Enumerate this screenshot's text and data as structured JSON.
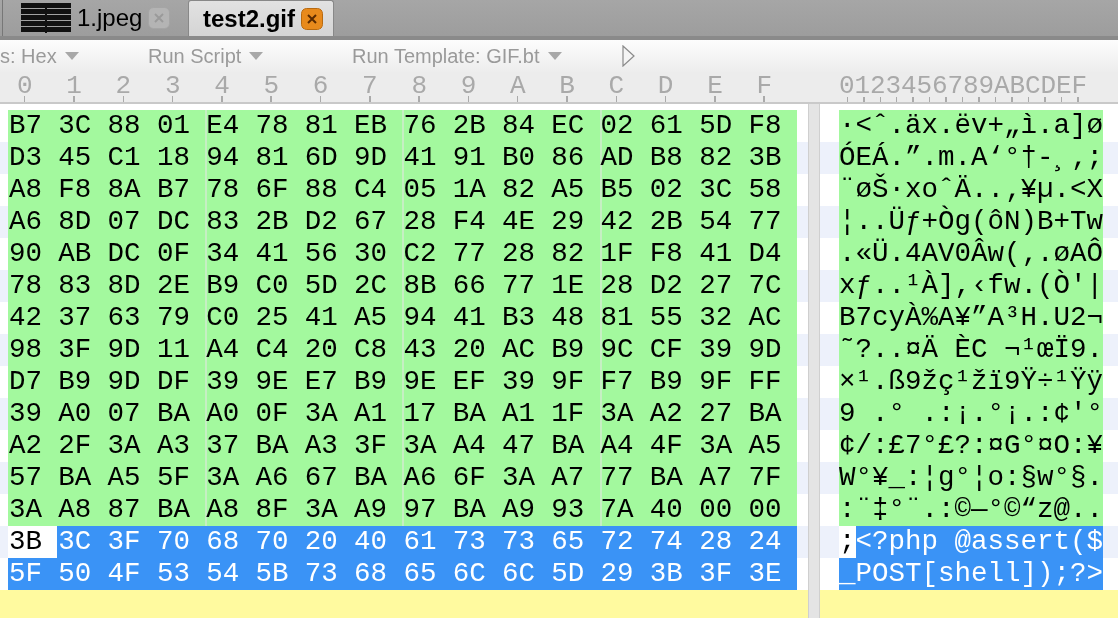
{
  "tabs": [
    {
      "label": "1.jpeg",
      "selected": false,
      "kind": "redacted"
    },
    {
      "label": "test2.gif",
      "selected": true,
      "kind": "plain"
    }
  ],
  "toolbar": [
    {
      "kind": "menu",
      "label": "s: Hex"
    },
    {
      "kind": "menu",
      "label": "Run Script"
    },
    {
      "kind": "menu",
      "label": "Run Template: GIF.bt"
    },
    {
      "kind": "play"
    }
  ],
  "ruler": {
    "hex_columns": [
      "0",
      "1",
      "2",
      "3",
      "4",
      "5",
      "6",
      "7",
      "8",
      "9",
      "A",
      "B",
      "C",
      "D",
      "E",
      "F"
    ],
    "text_header": "0123456789ABCDEF"
  },
  "rows": [
    {
      "template": true,
      "bytes": [
        {
          "hex": "B7",
          "char": "·",
          "selected": false
        },
        {
          "hex": "3C",
          "char": "<",
          "selected": false
        },
        {
          "hex": "88",
          "char": "ˆ",
          "selected": false
        },
        {
          "hex": "01",
          "char": ".",
          "selected": false
        },
        {
          "hex": "E4",
          "char": "ä",
          "selected": false
        },
        {
          "hex": "78",
          "char": "x",
          "selected": false
        },
        {
          "hex": "81",
          "char": ".",
          "selected": false
        },
        {
          "hex": "EB",
          "char": "ë",
          "selected": false
        },
        {
          "hex": "76",
          "char": "v",
          "selected": false
        },
        {
          "hex": "2B",
          "char": "+",
          "selected": false
        },
        {
          "hex": "84",
          "char": "„",
          "selected": false
        },
        {
          "hex": "EC",
          "char": "ì",
          "selected": false
        },
        {
          "hex": "02",
          "char": ".",
          "selected": false
        },
        {
          "hex": "61",
          "char": "a",
          "selected": false
        },
        {
          "hex": "5D",
          "char": "]",
          "selected": false
        },
        {
          "hex": "F8",
          "char": "ø",
          "selected": false
        }
      ]
    },
    {
      "template": true,
      "bytes": [
        {
          "hex": "D3",
          "char": "Ó",
          "selected": false
        },
        {
          "hex": "45",
          "char": "E",
          "selected": false
        },
        {
          "hex": "C1",
          "char": "Á",
          "selected": false
        },
        {
          "hex": "18",
          "char": ".",
          "selected": false
        },
        {
          "hex": "94",
          "char": "”",
          "selected": false
        },
        {
          "hex": "81",
          "char": ".",
          "selected": false
        },
        {
          "hex": "6D",
          "char": "m",
          "selected": false
        },
        {
          "hex": "9D",
          "char": ".",
          "selected": false
        },
        {
          "hex": "41",
          "char": "A",
          "selected": false
        },
        {
          "hex": "91",
          "char": "‘",
          "selected": false
        },
        {
          "hex": "B0",
          "char": "°",
          "selected": false
        },
        {
          "hex": "86",
          "char": "†",
          "selected": false
        },
        {
          "hex": "AD",
          "char": "-",
          "selected": false
        },
        {
          "hex": "B8",
          "char": "¸",
          "selected": false
        },
        {
          "hex": "82",
          "char": "‚",
          "selected": false
        },
        {
          "hex": "3B",
          "char": ";",
          "selected": false
        }
      ]
    },
    {
      "template": true,
      "bytes": [
        {
          "hex": "A8",
          "char": "¨",
          "selected": false
        },
        {
          "hex": "F8",
          "char": "ø",
          "selected": false
        },
        {
          "hex": "8A",
          "char": "Š",
          "selected": false
        },
        {
          "hex": "B7",
          "char": "·",
          "selected": false
        },
        {
          "hex": "78",
          "char": "x",
          "selected": false
        },
        {
          "hex": "6F",
          "char": "o",
          "selected": false
        },
        {
          "hex": "88",
          "char": "ˆ",
          "selected": false
        },
        {
          "hex": "C4",
          "char": "Ä",
          "selected": false
        },
        {
          "hex": "05",
          "char": ".",
          "selected": false
        },
        {
          "hex": "1A",
          "char": ".",
          "selected": false
        },
        {
          "hex": "82",
          "char": "‚",
          "selected": false
        },
        {
          "hex": "A5",
          "char": "¥",
          "selected": false
        },
        {
          "hex": "B5",
          "char": "µ",
          "selected": false
        },
        {
          "hex": "02",
          "char": ".",
          "selected": false
        },
        {
          "hex": "3C",
          "char": "<",
          "selected": false
        },
        {
          "hex": "58",
          "char": "X",
          "selected": false
        }
      ]
    },
    {
      "template": true,
      "bytes": [
        {
          "hex": "A6",
          "char": "¦",
          "selected": false
        },
        {
          "hex": "8D",
          "char": ".",
          "selected": false
        },
        {
          "hex": "07",
          "char": ".",
          "selected": false
        },
        {
          "hex": "DC",
          "char": "Ü",
          "selected": false
        },
        {
          "hex": "83",
          "char": "ƒ",
          "selected": false
        },
        {
          "hex": "2B",
          "char": "+",
          "selected": false
        },
        {
          "hex": "D2",
          "char": "Ò",
          "selected": false
        },
        {
          "hex": "67",
          "char": "g",
          "selected": false
        },
        {
          "hex": "28",
          "char": "(",
          "selected": false
        },
        {
          "hex": "F4",
          "char": "ô",
          "selected": false
        },
        {
          "hex": "4E",
          "char": "N",
          "selected": false
        },
        {
          "hex": "29",
          "char": ")",
          "selected": false
        },
        {
          "hex": "42",
          "char": "B",
          "selected": false
        },
        {
          "hex": "2B",
          "char": "+",
          "selected": false
        },
        {
          "hex": "54",
          "char": "T",
          "selected": false
        },
        {
          "hex": "77",
          "char": "w",
          "selected": false
        }
      ]
    },
    {
      "template": true,
      "bytes": [
        {
          "hex": "90",
          "char": ".",
          "selected": false
        },
        {
          "hex": "AB",
          "char": "«",
          "selected": false
        },
        {
          "hex": "DC",
          "char": "Ü",
          "selected": false
        },
        {
          "hex": "0F",
          "char": ".",
          "selected": false
        },
        {
          "hex": "34",
          "char": "4",
          "selected": false
        },
        {
          "hex": "41",
          "char": "A",
          "selected": false
        },
        {
          "hex": "56",
          "char": "V",
          "selected": false
        },
        {
          "hex": "30",
          "char": "0",
          "selected": false
        },
        {
          "hex": "C2",
          "char": "Â",
          "selected": false
        },
        {
          "hex": "77",
          "char": "w",
          "selected": false
        },
        {
          "hex": "28",
          "char": "(",
          "selected": false
        },
        {
          "hex": "82",
          "char": "‚",
          "selected": false
        },
        {
          "hex": "1F",
          "char": ".",
          "selected": false
        },
        {
          "hex": "F8",
          "char": "ø",
          "selected": false
        },
        {
          "hex": "41",
          "char": "A",
          "selected": false
        },
        {
          "hex": "D4",
          "char": "Ô",
          "selected": false
        }
      ]
    },
    {
      "template": true,
      "bytes": [
        {
          "hex": "78",
          "char": "x",
          "selected": false
        },
        {
          "hex": "83",
          "char": "ƒ",
          "selected": false
        },
        {
          "hex": "8D",
          "char": ".",
          "selected": false
        },
        {
          "hex": "2E",
          "char": ".",
          "selected": false
        },
        {
          "hex": "B9",
          "char": "¹",
          "selected": false
        },
        {
          "hex": "C0",
          "char": "À",
          "selected": false
        },
        {
          "hex": "5D",
          "char": "]",
          "selected": false
        },
        {
          "hex": "2C",
          "char": ",",
          "selected": false
        },
        {
          "hex": "8B",
          "char": "‹",
          "selected": false
        },
        {
          "hex": "66",
          "char": "f",
          "selected": false
        },
        {
          "hex": "77",
          "char": "w",
          "selected": false
        },
        {
          "hex": "1E",
          "char": ".",
          "selected": false
        },
        {
          "hex": "28",
          "char": "(",
          "selected": false
        },
        {
          "hex": "D2",
          "char": "Ò",
          "selected": false
        },
        {
          "hex": "27",
          "char": "'",
          "selected": false
        },
        {
          "hex": "7C",
          "char": "|",
          "selected": false
        }
      ]
    },
    {
      "template": true,
      "bytes": [
        {
          "hex": "42",
          "char": "B",
          "selected": false
        },
        {
          "hex": "37",
          "char": "7",
          "selected": false
        },
        {
          "hex": "63",
          "char": "c",
          "selected": false
        },
        {
          "hex": "79",
          "char": "y",
          "selected": false
        },
        {
          "hex": "C0",
          "char": "À",
          "selected": false
        },
        {
          "hex": "25",
          "char": "%",
          "selected": false
        },
        {
          "hex": "41",
          "char": "A",
          "selected": false
        },
        {
          "hex": "A5",
          "char": "¥",
          "selected": false
        },
        {
          "hex": "94",
          "char": "”",
          "selected": false
        },
        {
          "hex": "41",
          "char": "A",
          "selected": false
        },
        {
          "hex": "B3",
          "char": "³",
          "selected": false
        },
        {
          "hex": "48",
          "char": "H",
          "selected": false
        },
        {
          "hex": "81",
          "char": ".",
          "selected": false
        },
        {
          "hex": "55",
          "char": "U",
          "selected": false
        },
        {
          "hex": "32",
          "char": "2",
          "selected": false
        },
        {
          "hex": "AC",
          "char": "¬",
          "selected": false
        }
      ]
    },
    {
      "template": true,
      "bytes": [
        {
          "hex": "98",
          "char": "˜",
          "selected": false
        },
        {
          "hex": "3F",
          "char": "?",
          "selected": false
        },
        {
          "hex": "9D",
          "char": ".",
          "selected": false
        },
        {
          "hex": "11",
          "char": ".",
          "selected": false
        },
        {
          "hex": "A4",
          "char": "¤",
          "selected": false
        },
        {
          "hex": "C4",
          "char": "Ä",
          "selected": false
        },
        {
          "hex": "20",
          "selected": false
        },
        {
          "hex": "C8",
          "char": "È",
          "selected": false
        },
        {
          "hex": "43",
          "char": "C",
          "selected": false
        },
        {
          "hex": "20",
          "selected": false
        },
        {
          "hex": "AC",
          "char": "¬",
          "selected": false
        },
        {
          "hex": "B9",
          "char": "¹",
          "selected": false
        },
        {
          "hex": "9C",
          "char": "œ",
          "selected": false
        },
        {
          "hex": "CF",
          "char": "Ï",
          "selected": false
        },
        {
          "hex": "39",
          "char": "9",
          "selected": false
        },
        {
          "hex": "9D",
          "char": ".",
          "selected": false
        }
      ]
    },
    {
      "template": true,
      "bytes": [
        {
          "hex": "D7",
          "char": "×",
          "selected": false
        },
        {
          "hex": "B9",
          "char": "¹",
          "selected": false
        },
        {
          "hex": "9D",
          "char": ".",
          "selected": false
        },
        {
          "hex": "DF",
          "char": "ß",
          "selected": false
        },
        {
          "hex": "39",
          "char": "9",
          "selected": false
        },
        {
          "hex": "9E",
          "char": "ž",
          "selected": false
        },
        {
          "hex": "E7",
          "char": "ç",
          "selected": false
        },
        {
          "hex": "B9",
          "char": "¹",
          "selected": false
        },
        {
          "hex": "9E",
          "char": "ž",
          "selected": false
        },
        {
          "hex": "EF",
          "char": "ï",
          "selected": false
        },
        {
          "hex": "39",
          "char": "9",
          "selected": false
        },
        {
          "hex": "9F",
          "char": "Ÿ",
          "selected": false
        },
        {
          "hex": "F7",
          "char": "÷",
          "selected": false
        },
        {
          "hex": "B9",
          "char": "¹",
          "selected": false
        },
        {
          "hex": "9F",
          "char": "Ÿ",
          "selected": false
        },
        {
          "hex": "FF",
          "char": "ÿ",
          "selected": false
        }
      ]
    },
    {
      "template": true,
      "bytes": [
        {
          "hex": "39",
          "char": "9",
          "selected": false
        },
        {
          "hex": "A0",
          "selected": false
        },
        {
          "hex": "07",
          "char": ".",
          "selected": false
        },
        {
          "hex": "BA",
          "char": "°",
          "selected": false
        },
        {
          "hex": "A0",
          "selected": false
        },
        {
          "hex": "0F",
          "char": ".",
          "selected": false
        },
        {
          "hex": "3A",
          "char": ":",
          "selected": false
        },
        {
          "hex": "A1",
          "char": "¡",
          "selected": false
        },
        {
          "hex": "17",
          "char": ".",
          "selected": false
        },
        {
          "hex": "BA",
          "char": "°",
          "selected": false
        },
        {
          "hex": "A1",
          "char": "¡",
          "selected": false
        },
        {
          "hex": "1F",
          "char": ".",
          "selected": false
        },
        {
          "hex": "3A",
          "char": ":",
          "selected": false
        },
        {
          "hex": "A2",
          "char": "¢",
          "selected": false
        },
        {
          "hex": "27",
          "char": "'",
          "selected": false
        },
        {
          "hex": "BA",
          "char": "°",
          "selected": false
        }
      ]
    },
    {
      "template": true,
      "bytes": [
        {
          "hex": "A2",
          "char": "¢",
          "selected": false
        },
        {
          "hex": "2F",
          "char": "/",
          "selected": false
        },
        {
          "hex": "3A",
          "char": ":",
          "selected": false
        },
        {
          "hex": "A3",
          "char": "£",
          "selected": false
        },
        {
          "hex": "37",
          "char": "7",
          "selected": false
        },
        {
          "hex": "BA",
          "char": "°",
          "selected": false
        },
        {
          "hex": "A3",
          "char": "£",
          "selected": false
        },
        {
          "hex": "3F",
          "char": "?",
          "selected": false
        },
        {
          "hex": "3A",
          "char": ":",
          "selected": false
        },
        {
          "hex": "A4",
          "char": "¤",
          "selected": false
        },
        {
          "hex": "47",
          "char": "G",
          "selected": false
        },
        {
          "hex": "BA",
          "char": "°",
          "selected": false
        },
        {
          "hex": "A4",
          "char": "¤",
          "selected": false
        },
        {
          "hex": "4F",
          "char": "O",
          "selected": false
        },
        {
          "hex": "3A",
          "char": ":",
          "selected": false
        },
        {
          "hex": "A5",
          "char": "¥",
          "selected": false
        }
      ]
    },
    {
      "template": true,
      "bytes": [
        {
          "hex": "57",
          "char": "W",
          "selected": false
        },
        {
          "hex": "BA",
          "char": "°",
          "selected": false
        },
        {
          "hex": "A5",
          "char": "¥",
          "selected": false
        },
        {
          "hex": "5F",
          "char": "_",
          "selected": false
        },
        {
          "hex": "3A",
          "char": ":",
          "selected": false
        },
        {
          "hex": "A6",
          "char": "¦",
          "selected": false
        },
        {
          "hex": "67",
          "char": "g",
          "selected": false
        },
        {
          "hex": "BA",
          "char": "°",
          "selected": false
        },
        {
          "hex": "A6",
          "char": "¦",
          "selected": false
        },
        {
          "hex": "6F",
          "char": "o",
          "selected": false
        },
        {
          "hex": "3A",
          "char": ":",
          "selected": false
        },
        {
          "hex": "A7",
          "char": "§",
          "selected": false
        },
        {
          "hex": "77",
          "char": "w",
          "selected": false
        },
        {
          "hex": "BA",
          "char": "°",
          "selected": false
        },
        {
          "hex": "A7",
          "char": "§",
          "selected": false
        },
        {
          "hex": "7F",
          "char": ".",
          "selected": false
        }
      ]
    },
    {
      "template": true,
      "bytes": [
        {
          "hex": "3A",
          "char": ":",
          "selected": false
        },
        {
          "hex": "A8",
          "char": "¨",
          "selected": false
        },
        {
          "hex": "87",
          "char": "‡",
          "selected": false
        },
        {
          "hex": "BA",
          "char": "°",
          "selected": false
        },
        {
          "hex": "A8",
          "char": "¨",
          "selected": false
        },
        {
          "hex": "8F",
          "char": ".",
          "selected": false
        },
        {
          "hex": "3A",
          "char": ":",
          "selected": false
        },
        {
          "hex": "A9",
          "char": "©",
          "selected": false
        },
        {
          "hex": "97",
          "char": "—",
          "selected": false
        },
        {
          "hex": "BA",
          "char": "°",
          "selected": false
        },
        {
          "hex": "A9",
          "char": "©",
          "selected": false
        },
        {
          "hex": "93",
          "char": "“",
          "selected": false
        },
        {
          "hex": "7A",
          "char": "z",
          "selected": false
        },
        {
          "hex": "40",
          "char": "@",
          "selected": false
        },
        {
          "hex": "00",
          "char": ".",
          "selected": false
        },
        {
          "hex": "00",
          "char": ".",
          "selected": false
        }
      ]
    },
    {
      "template": false,
      "bytes": [
        {
          "hex": "3B",
          "char": ";",
          "selected": false
        },
        {
          "hex": "3C",
          "char": "<",
          "selected": true
        },
        {
          "hex": "3F",
          "char": "?",
          "selected": true
        },
        {
          "hex": "70",
          "char": "p",
          "selected": true
        },
        {
          "hex": "68",
          "char": "h",
          "selected": true
        },
        {
          "hex": "70",
          "char": "p",
          "selected": true
        },
        {
          "hex": "20",
          "selected": true
        },
        {
          "hex": "40",
          "char": "@",
          "selected": true
        },
        {
          "hex": "61",
          "char": "a",
          "selected": true
        },
        {
          "hex": "73",
          "char": "s",
          "selected": true
        },
        {
          "hex": "73",
          "char": "s",
          "selected": true
        },
        {
          "hex": "65",
          "char": "e",
          "selected": true
        },
        {
          "hex": "72",
          "char": "r",
          "selected": true
        },
        {
          "hex": "74",
          "char": "t",
          "selected": true
        },
        {
          "hex": "28",
          "char": "(",
          "selected": true
        },
        {
          "hex": "24",
          "char": "$",
          "selected": true
        }
      ]
    },
    {
      "bytes": [
        {
          "hex": "5F",
          "char": "_",
          "selected": true
        },
        {
          "hex": "50",
          "char": "P",
          "selected": true
        },
        {
          "hex": "4F",
          "char": "O",
          "selected": true
        },
        {
          "hex": "53",
          "char": "S",
          "selected": true
        },
        {
          "hex": "54",
          "char": "T",
          "selected": true
        },
        {
          "hex": "5B",
          "char": "[",
          "selected": true
        },
        {
          "hex": "73",
          "char": "s",
          "selected": true
        },
        {
          "hex": "68",
          "char": "h",
          "selected": true
        },
        {
          "hex": "65",
          "char": "e",
          "selected": true
        },
        {
          "hex": "6C",
          "char": "l",
          "selected": true
        },
        {
          "hex": "6C",
          "char": "l",
          "selected": true
        },
        {
          "hex": "5D",
          "char": "]",
          "selected": true
        },
        {
          "hex": "29",
          "char": ")",
          "selected": true
        },
        {
          "hex": "3B",
          "char": ";",
          "selected": true
        },
        {
          "hex": "3F",
          "char": "?",
          "selected": true
        },
        {
          "hex": "3E",
          "char": ">",
          "selected": true
        }
      ]
    }
  ]
}
